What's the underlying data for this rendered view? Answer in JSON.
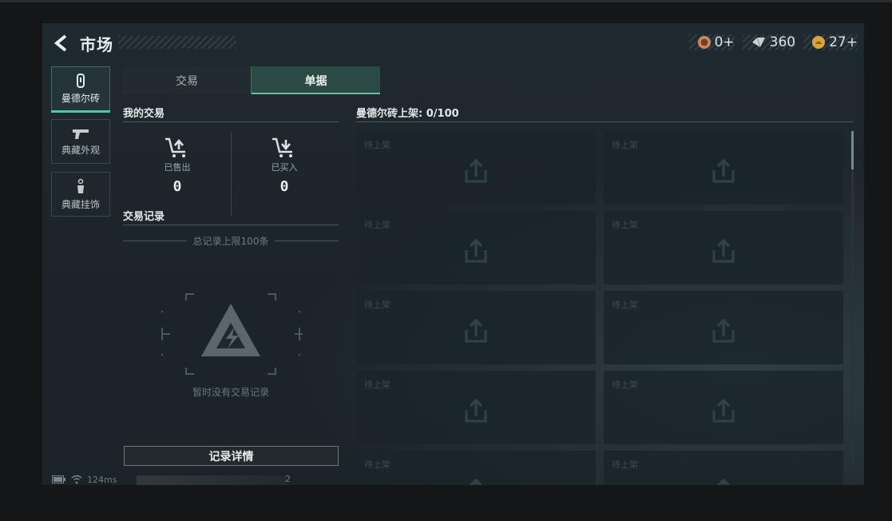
{
  "header": {
    "title": "市场",
    "currencies": [
      {
        "icon": "token-icon",
        "value": "0+"
      },
      {
        "icon": "diamond-icon",
        "value": "360"
      },
      {
        "icon": "coin-icon",
        "value": "27+"
      }
    ]
  },
  "sidebar": {
    "items": [
      {
        "icon": "key-card-icon",
        "label": "曼德尔砖",
        "active": true
      },
      {
        "icon": "pistol-icon",
        "label": "典藏外观"
      },
      {
        "icon": "charm-icon",
        "label": "典藏挂饰"
      }
    ]
  },
  "tabs": [
    {
      "label": "交易"
    },
    {
      "label": "单据",
      "active": true
    }
  ],
  "my_trades": {
    "heading": "我的交易",
    "sold": {
      "label": "已售出",
      "value": "0"
    },
    "bought": {
      "label": "已买入",
      "value": "0"
    }
  },
  "trade_records": {
    "heading": "交易记录",
    "limit_text": "总记录上限100条",
    "empty_text": "暂时没有交易记录",
    "detail_button": "记录详情"
  },
  "listings": {
    "heading": "曼德尔砖上架: 0/100",
    "slot_label": "待上架",
    "slots": [
      "待上架",
      "待上架",
      "待上架",
      "待上架",
      "待上架",
      "待上架",
      "待上架",
      "待上架",
      "待上架",
      "待上架"
    ]
  },
  "status_bar": {
    "ping": "124ms",
    "number": "2"
  },
  "colors": {
    "accent": "#59c4a7",
    "active_tab_bg": "#2c4a44",
    "panel_bg": "#1c252a"
  }
}
